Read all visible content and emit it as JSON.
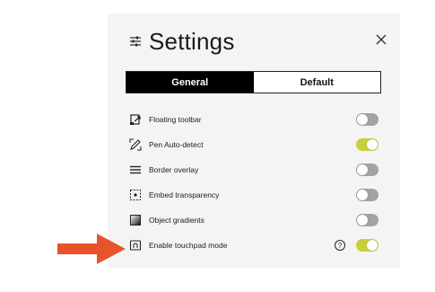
{
  "header": {
    "title": "Settings",
    "settings_icon": "sliders-icon",
    "close_icon": "close-icon"
  },
  "tabs": [
    {
      "label": "General",
      "active": true
    },
    {
      "label": "Default",
      "active": false
    }
  ],
  "options": [
    {
      "label": "Floating toolbar",
      "icon": "floating-toolbar-icon",
      "enabled": false
    },
    {
      "label": "Pen Auto-detect",
      "icon": "pen-icon",
      "enabled": true
    },
    {
      "label": "Border overlay",
      "icon": "border-lines-icon",
      "enabled": false
    },
    {
      "label": "Embed transparency",
      "icon": "transparency-icon",
      "enabled": false
    },
    {
      "label": "Object gradients",
      "icon": "gradient-icon",
      "enabled": false
    },
    {
      "label": "Enable touchpad mode",
      "icon": "touchpad-icon",
      "enabled": true
    }
  ],
  "help_label": "?",
  "colors": {
    "accent_on": "#c7cf3c",
    "toggle_off": "#a3a3a3",
    "arrow": "#e8542a"
  }
}
